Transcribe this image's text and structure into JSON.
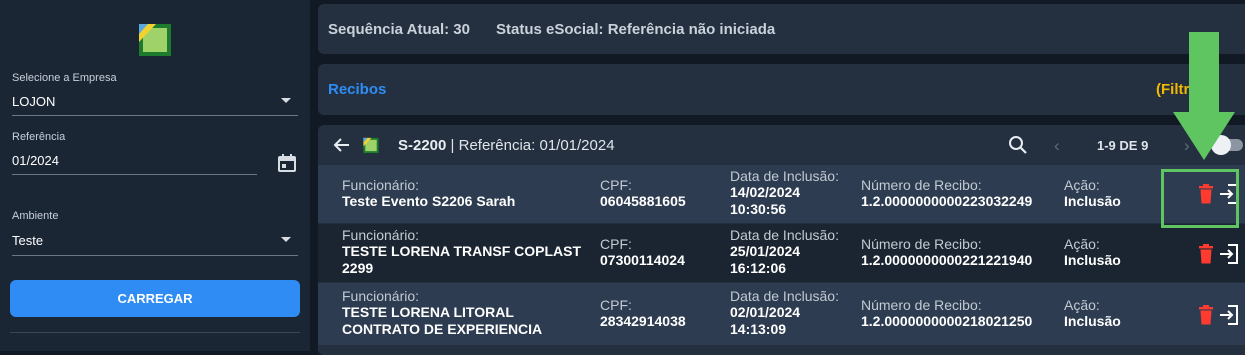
{
  "sidebar": {
    "empresa": {
      "label": "Selecione a Empresa",
      "value": "LOJON"
    },
    "referencia": {
      "label": "Referência",
      "value": "01/2024"
    },
    "ambiente": {
      "label": "Ambiente",
      "value": "Teste"
    },
    "carregar_label": "CARREGAR"
  },
  "header": {
    "sequencia": "Sequência Atual: 30",
    "status": "Status eSocial: Referência não iniciada"
  },
  "recibos": {
    "title": "Recibos",
    "filter_label_partial": "(Filtrada"
  },
  "panel": {
    "event_code": "S-2200",
    "referencia_text": " | Referência: 01/01/2024",
    "pagination": "1-9 DE 9"
  },
  "labels": {
    "funcionario": "Funcionário:",
    "cpf": "CPF:",
    "data_inclusao": "Data de Inclusão:",
    "numero_recibo": "Número de Recibo:",
    "acao": "Ação:"
  },
  "rows": [
    {
      "funcionario": "Teste Evento S2206 Sarah",
      "cpf": "06045881605",
      "data": "14/02/2024",
      "hora": "10:30:56",
      "recibo": "1.2.0000000000223032249",
      "acao": "Inclusão"
    },
    {
      "funcionario": "TESTE LORENA TRANSF COPLAST 2299",
      "cpf": "07300114024",
      "data": "25/01/2024",
      "hora": "16:12:06",
      "recibo": "1.2.0000000000221221940",
      "acao": "Inclusão"
    },
    {
      "funcionario": "TESTE LORENA LITORAL CONTRATO DE EXPERIENCIA",
      "cpf": "28342914038",
      "data": "02/01/2024",
      "hora": "14:13:09",
      "recibo": "1.2.0000000000218021250",
      "acao": "Inclusão"
    }
  ],
  "icons": {
    "delete": "trash-icon",
    "open": "exit-icon",
    "search": "search-icon",
    "back": "arrow-left-icon",
    "calendar": "calendar-icon"
  },
  "colors": {
    "accent": "#2f8cf4",
    "filter": "#f2b900",
    "delete": "#ff3b30",
    "highlight": "#5ec560"
  }
}
